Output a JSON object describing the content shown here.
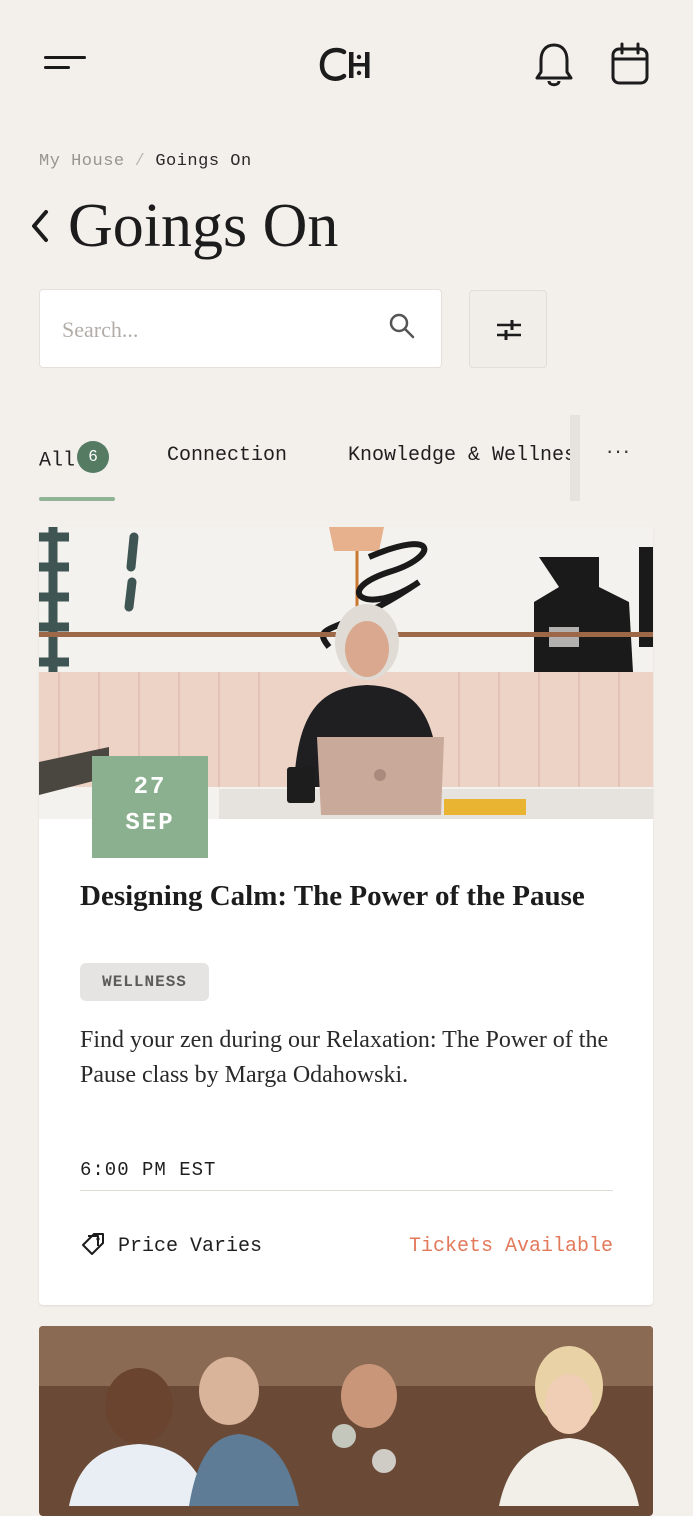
{
  "header": {
    "menu_icon": "hamburger-icon",
    "logo_text": "CH",
    "notifications_icon": "bell-icon",
    "calendar_icon": "calendar-icon"
  },
  "breadcrumb": {
    "parent": "My House",
    "separator": "/",
    "current": "Goings On"
  },
  "page": {
    "title": "Goings On",
    "back_icon": "chevron-left-icon"
  },
  "search": {
    "placeholder": "Search...",
    "value": "",
    "icon": "search-icon",
    "filter_icon": "sliders-icon"
  },
  "tabs": {
    "items": [
      {
        "label": "All",
        "count": "6",
        "active": true
      },
      {
        "label": "Connection"
      },
      {
        "label": "Knowledge & Wellness"
      }
    ],
    "more_label": "···",
    "accent": "#8fb394",
    "badge_color": "#557b63"
  },
  "events": [
    {
      "date_day": "27",
      "date_month": "SEP",
      "title": "Designing Calm: The Power of the Pause",
      "category": "WELLNESS",
      "description": "Find your zen during our Relaxation: The Power of the Pause class by Marga Odahowski.",
      "time": "6:00 PM EST",
      "price": "Price Varies",
      "availability": "Tickets Available",
      "badge_color": "#8ab08f",
      "availability_color": "#e2795a"
    },
    {
      "image": "group-toasting-photo"
    }
  ]
}
